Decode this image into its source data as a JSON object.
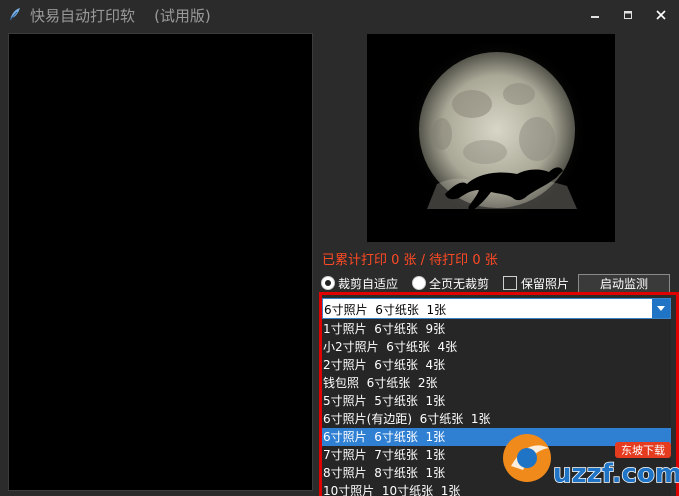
{
  "window": {
    "title": "快易自动打印软    (试用版)",
    "minimize_label": "minimize",
    "maximize_label": "maximize",
    "close_label": "close"
  },
  "status": {
    "text": "已累计打印 0 张 / 待打印 0 张"
  },
  "options": {
    "crop_fit_label": "裁剪自适应",
    "crop_fit_selected": true,
    "full_page_label": "全页无裁剪",
    "full_page_selected": false,
    "keep_photo_label": "保留照片",
    "keep_photo_checked": false,
    "start_button_label": "启动监测"
  },
  "size_select": {
    "selected": "6寸照片  6寸纸张  1张",
    "options": [
      "1寸照片  6寸纸张  9张",
      "小2寸照片  6寸纸张  4张",
      "2寸照片  6寸纸张  4张",
      "钱包照  6寸纸张  2张",
      "5寸照片  5寸纸张  1张",
      "6寸照片(有边距)  6寸纸张  1张",
      "6寸照片  6寸纸张  1张",
      "7寸照片  7寸纸张  1张",
      "8寸照片  8寸纸张  1张",
      "10寸照片  10寸纸张  1张"
    ],
    "highlighted_index": 6
  },
  "watermark": {
    "brand_text": "uzzf.com",
    "tag_text": "东坡下载"
  },
  "colors": {
    "background": "#2b2b2b",
    "status_text": "#ff4a24",
    "highlight": "#2f7fd3",
    "frame": "#e00000"
  }
}
